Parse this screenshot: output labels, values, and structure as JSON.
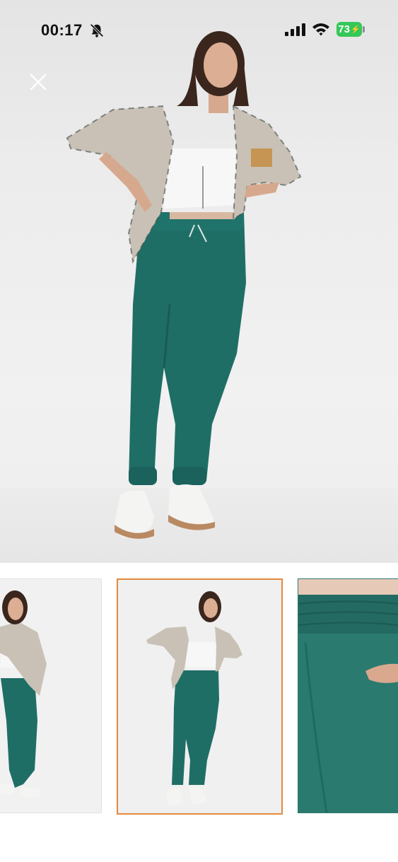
{
  "status_bar": {
    "time": "00:17",
    "battery": "73",
    "icons": [
      "bell-slash-icon",
      "cellular-signal-icon",
      "wifi-icon",
      "battery-charging-icon"
    ]
  },
  "controls": {
    "close_icon": "close-icon"
  },
  "gallery": {
    "selected_index": 1,
    "thumbnails": [
      "product-photo-front-cropped",
      "product-photo-full",
      "product-photo-waistband-detail"
    ]
  },
  "colors": {
    "accent_selected": "#e48a3a",
    "pants_green": "#1f6e66",
    "battery_green": "#34c759"
  }
}
